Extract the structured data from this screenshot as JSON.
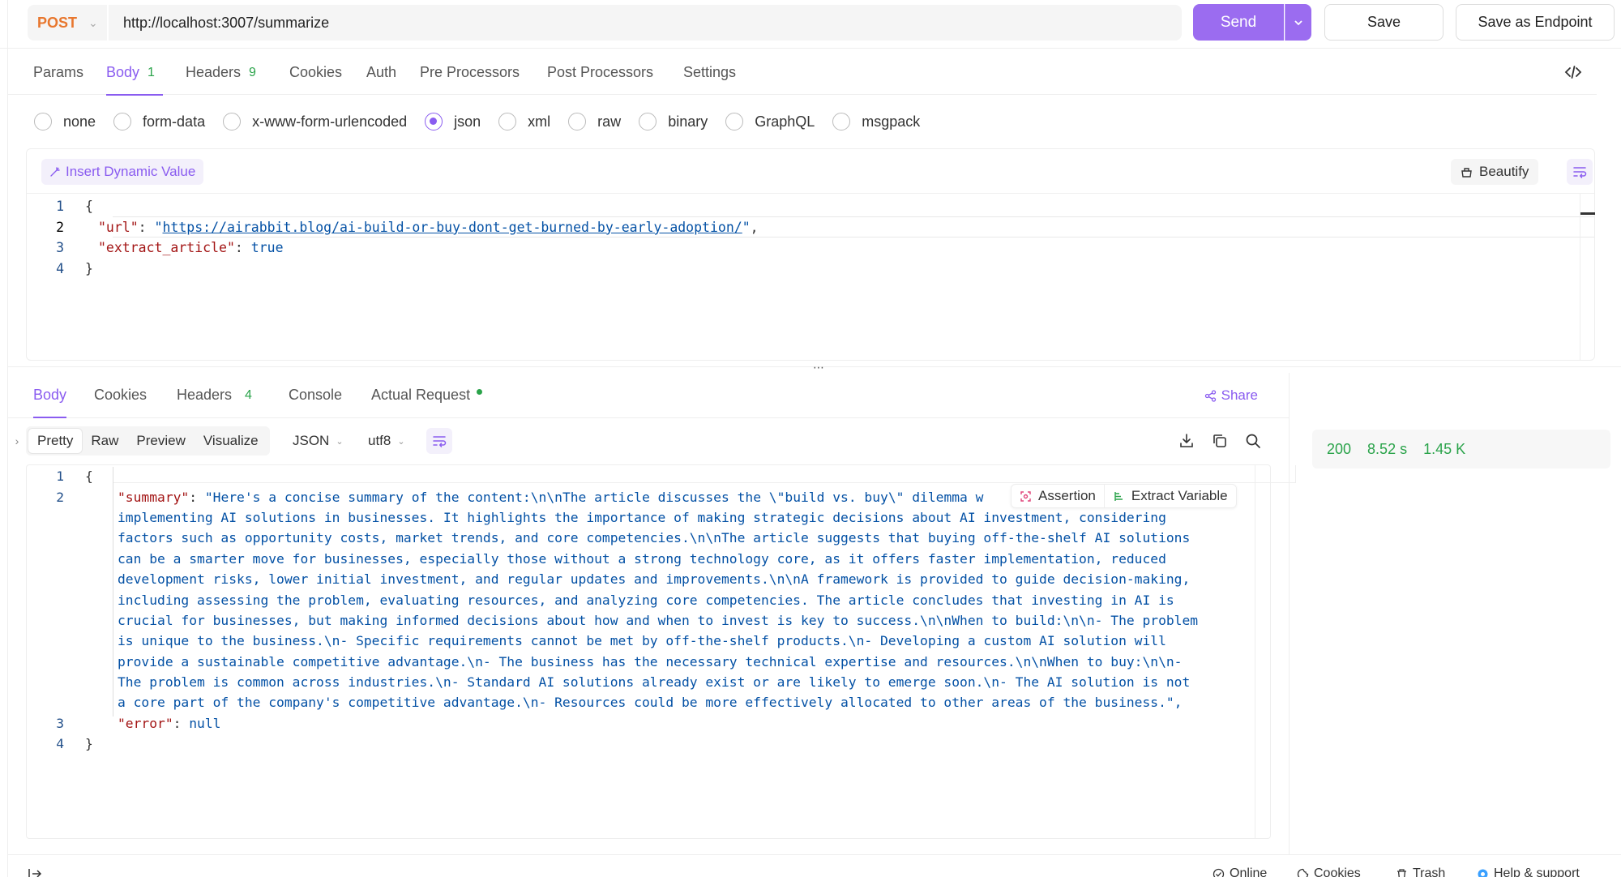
{
  "request": {
    "method": "POST",
    "url": "http://localhost:3007/summarize",
    "send_label": "Send",
    "save_label": "Save",
    "save_endpoint_label": "Save as Endpoint"
  },
  "request_tabs": [
    {
      "label": "Params",
      "count": ""
    },
    {
      "label": "Body",
      "count": "1"
    },
    {
      "label": "Headers",
      "count": "9"
    },
    {
      "label": "Cookies",
      "count": ""
    },
    {
      "label": "Auth",
      "count": ""
    },
    {
      "label": "Pre Processors",
      "count": ""
    },
    {
      "label": "Post Processors",
      "count": ""
    },
    {
      "label": "Settings",
      "count": ""
    }
  ],
  "body_types": [
    "none",
    "form-data",
    "x-www-form-urlencoded",
    "json",
    "xml",
    "raw",
    "binary",
    "GraphQL",
    "msgpack"
  ],
  "body_type_selected": "json",
  "editor": {
    "insert_dynamic": "Insert Dynamic Value",
    "beautify": "Beautify",
    "lines": [
      {
        "n": "1"
      },
      {
        "n": "2",
        "key": "\"url\"",
        "sep": ": ",
        "q1": "\"",
        "url": "https://airabbit.blog/ai-build-or-buy-dont-get-burned-by-early-adoption/",
        "q2": "\"",
        "tail": ","
      },
      {
        "n": "3",
        "key": "\"extract_article\"",
        "sep": ": ",
        "val": "true"
      },
      {
        "n": "4"
      }
    ],
    "open_brace": "{",
    "close_brace": "}"
  },
  "response_tabs": [
    {
      "label": "Body",
      "count": ""
    },
    {
      "label": "Cookies",
      "count": ""
    },
    {
      "label": "Headers",
      "count": "4"
    },
    {
      "label": "Console",
      "count": ""
    },
    {
      "label": "Actual Request",
      "count": ""
    }
  ],
  "share_label": "Share",
  "response_view_modes": [
    "Pretty",
    "Raw",
    "Preview",
    "Visualize"
  ],
  "response_format": "JSON",
  "response_encoding": "utf8",
  "response_status": {
    "code": "200",
    "time": "8.52 s",
    "size": "1.45 K"
  },
  "response_actions": {
    "assertion": "Assertion",
    "extract": "Extract Variable"
  },
  "response_body": {
    "line_numbers": [
      "1",
      "2",
      "3",
      "4"
    ],
    "open_brace": "{",
    "summary_key": "\"summary\"",
    "summary_lines": [
      "\"Here's a concise summary of the content:\\n\\nThe article discusses the \\\"build vs. buy\\\" dilemma w",
      "implementing AI solutions in businesses. It highlights the importance of making strategic decisions about AI investment, considering",
      "factors such as opportunity costs, market trends, and core competencies.\\n\\nThe article suggests that buying off-the-shelf AI solutions",
      "can be a smarter move for businesses, especially those without a strong technology core, as it offers faster implementation, reduced",
      "development risks, lower initial investment, and regular updates and improvements.\\n\\nA framework is provided to guide decision-making,",
      "including assessing the problem, evaluating resources, and analyzing core competencies. The article concludes that investing in AI is",
      "crucial for businesses, but making informed decisions about how and when to invest is key to success.\\n\\nWhen to build:\\n\\n- The problem",
      "is unique to the business.\\n- Specific requirements cannot be met by off-the-shelf products.\\n- Developing a custom AI solution will",
      "provide a sustainable competitive advantage.\\n- The business has the necessary technical expertise and resources.\\n\\nWhen to buy:\\n\\n-",
      "The problem is common across industries.\\n- Standard AI solutions already exist or are likely to emerge soon.\\n- The AI solution is not",
      "a core part of the company's competitive advantage.\\n- Resources could be more effectively allocated to other areas of the business.\","
    ],
    "error_key": "\"error\"",
    "error_val": "null",
    "close_brace": "}"
  },
  "footer": {
    "online": "Online",
    "cookies": "Cookies",
    "trash": "Trash",
    "help": "Help & support"
  },
  "colors": {
    "accent": "#9b6cf0",
    "method": "#e8772e",
    "success": "#2aa34a",
    "json_key": "#a31515",
    "json_string": "#0451a5"
  }
}
